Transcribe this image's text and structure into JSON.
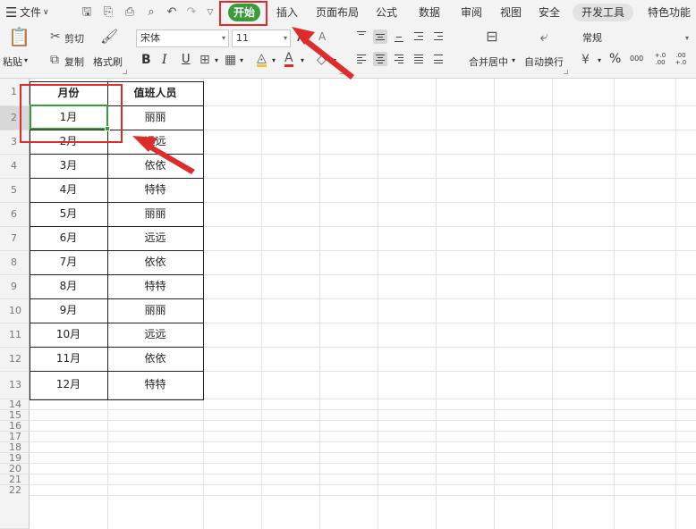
{
  "menubar": {
    "menu_icon": "hamburger-icon",
    "file_label": "文件",
    "tabs": [
      "开始",
      "插入",
      "页面布局",
      "公式",
      "数据",
      "审阅",
      "视图",
      "安全",
      "开发工具",
      "特色功能"
    ]
  },
  "ribbon": {
    "paste_label": "粘贴",
    "cut_label": "剪切",
    "copy_label": "复制",
    "format_painter_label": "格式刷",
    "font_name": "宋体",
    "font_size": "11",
    "grow_font": "A",
    "shrink_font": "A",
    "bold": "B",
    "italic": "I",
    "underline": "U",
    "merge_center_label": "合并居中",
    "wrap_text_label": "自动换行",
    "number_format": "常规",
    "percent": "%",
    "thousands": "000",
    "inc_decimal": "+.0 .00",
    "dec_decimal": ".00 +.0"
  },
  "sheet": {
    "row_numbers": [
      "1",
      "2",
      "3",
      "4",
      "5",
      "6",
      "7",
      "8",
      "9",
      "10",
      "11",
      "12",
      "13",
      "14",
      "15",
      "16",
      "17",
      "18",
      "19",
      "20",
      "21",
      "22"
    ],
    "headers": [
      "月份",
      "值班人员"
    ],
    "rows": [
      [
        "1月",
        "丽丽"
      ],
      [
        "2月",
        "远远"
      ],
      [
        "3月",
        "依依"
      ],
      [
        "4月",
        "特特"
      ],
      [
        "5月",
        "丽丽"
      ],
      [
        "6月",
        "远远"
      ],
      [
        "7月",
        "依依"
      ],
      [
        "8月",
        "特特"
      ],
      [
        "9月",
        "丽丽"
      ],
      [
        "10月",
        "远远"
      ],
      [
        "11月",
        "依依"
      ],
      [
        "12月",
        "特特"
      ]
    ]
  },
  "colors": {
    "accent_green": "#3a9b3a",
    "annotation_red": "#e02b2b"
  }
}
